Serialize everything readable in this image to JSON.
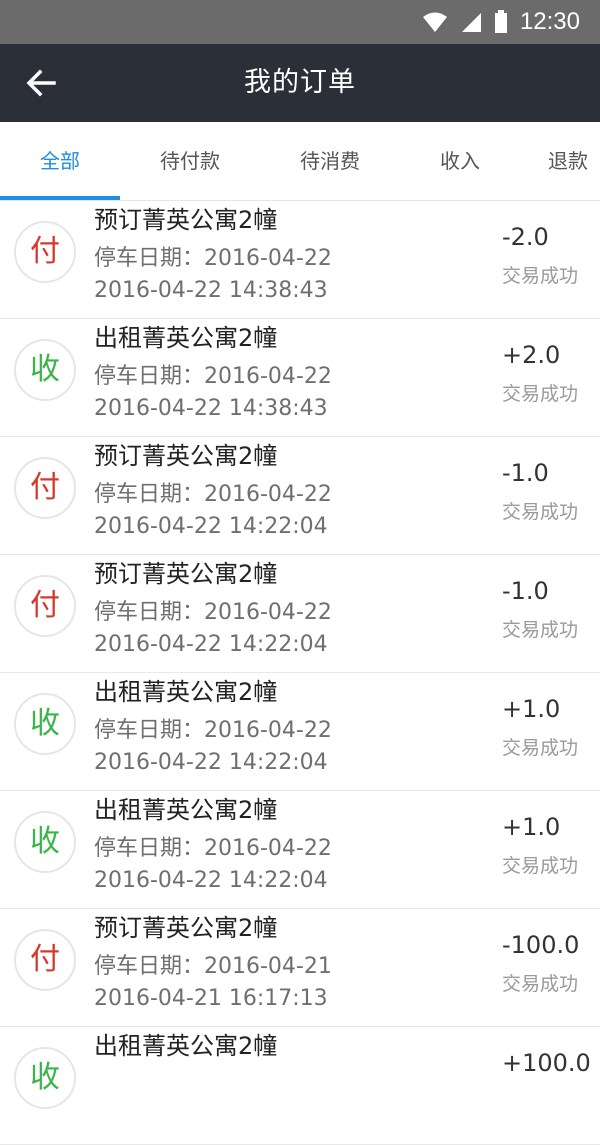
{
  "status_bar": {
    "time": "12:30",
    "icons": [
      "wifi-icon",
      "signal-icon",
      "battery-icon"
    ]
  },
  "app_bar": {
    "title": "我的订单",
    "back_icon": "arrow-left-icon"
  },
  "tabs": [
    {
      "label": "全部",
      "active": true
    },
    {
      "label": "待付款",
      "active": false
    },
    {
      "label": "待消费",
      "active": false
    },
    {
      "label": "收入",
      "active": false
    },
    {
      "label": "退款",
      "active": false
    }
  ],
  "colors": {
    "accent": "#1f8de2",
    "pay_badge": "#d23a2f",
    "receive_badge": "#39b54a",
    "app_bar_bg": "#2b3038",
    "status_bar_bg": "#6b6b6b"
  },
  "orders": [
    {
      "badge": "付",
      "kind": "pay",
      "title": "预订菁英公寓2幢",
      "park_date": "停车日期：2016-04-22",
      "datetime": "2016-04-22 14:38:43",
      "amount": "-2.0",
      "status": "交易成功"
    },
    {
      "badge": "收",
      "kind": "receive",
      "title": "出租菁英公寓2幢",
      "park_date": "停车日期：2016-04-22",
      "datetime": "2016-04-22 14:38:43",
      "amount": "+2.0",
      "status": "交易成功"
    },
    {
      "badge": "付",
      "kind": "pay",
      "title": "预订菁英公寓2幢",
      "park_date": "停车日期：2016-04-22",
      "datetime": "2016-04-22 14:22:04",
      "amount": "-1.0",
      "status": "交易成功"
    },
    {
      "badge": "付",
      "kind": "pay",
      "title": "预订菁英公寓2幢",
      "park_date": "停车日期：2016-04-22",
      "datetime": "2016-04-22 14:22:04",
      "amount": "-1.0",
      "status": "交易成功"
    },
    {
      "badge": "收",
      "kind": "receive",
      "title": "出租菁英公寓2幢",
      "park_date": "停车日期：2016-04-22",
      "datetime": "2016-04-22 14:22:04",
      "amount": "+1.0",
      "status": "交易成功"
    },
    {
      "badge": "收",
      "kind": "receive",
      "title": "出租菁英公寓2幢",
      "park_date": "停车日期：2016-04-22",
      "datetime": "2016-04-22 14:22:04",
      "amount": "+1.0",
      "status": "交易成功"
    },
    {
      "badge": "付",
      "kind": "pay",
      "title": "预订菁英公寓2幢",
      "park_date": "停车日期：2016-04-21",
      "datetime": "2016-04-21 16:17:13",
      "amount": "-100.0",
      "status": "交易成功"
    },
    {
      "badge": "收",
      "kind": "receive",
      "title": "出租菁英公寓2幢",
      "park_date": "",
      "datetime": "",
      "amount": "+100.0",
      "status": ""
    }
  ]
}
